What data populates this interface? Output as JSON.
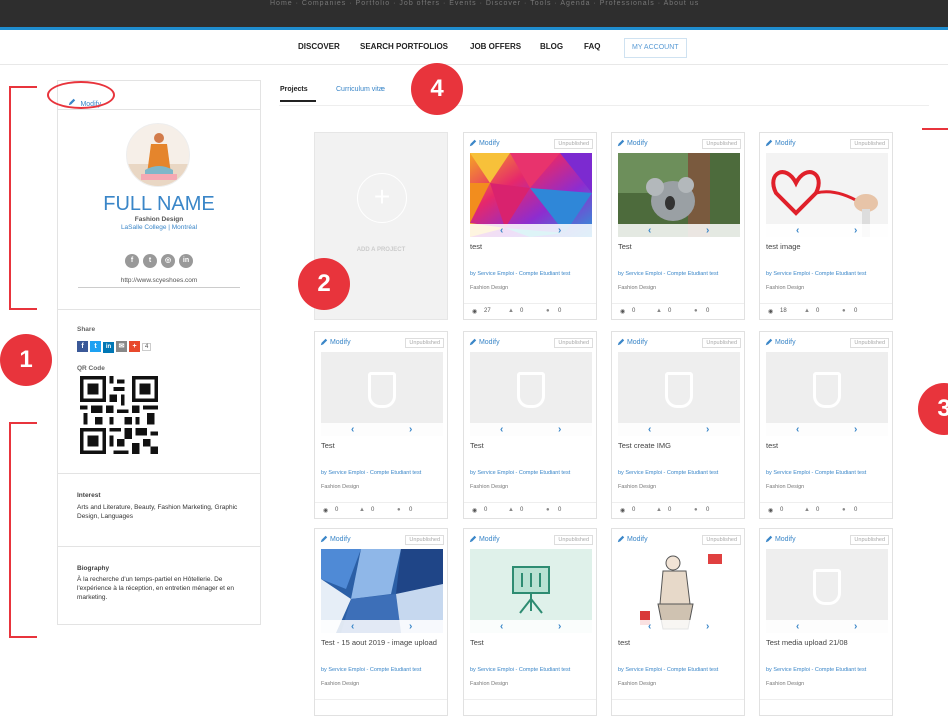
{
  "topbar": {
    "links": "Home · Companies · Portfolio · Job offers · Events · Discover · Tools · Agenda · Professionals · About us"
  },
  "nav": {
    "items": [
      "DISCOVER",
      "SEARCH PORTFOLIOS",
      "JOB OFFERS",
      "BLOG",
      "FAQ"
    ],
    "account": "MY ACCOUNT"
  },
  "sidebar": {
    "modify": "Modify",
    "full_name": "FULL NAME",
    "program": "Fashion Design",
    "school": "LaSalle College | Montréal",
    "social_icons": [
      "facebook-icon",
      "twitter-icon",
      "instagram-icon",
      "linkedin-icon"
    ],
    "website": "http://www.scyeshoes.com",
    "share_label": "Share",
    "share_count": "4",
    "qr_label": "QR Code",
    "interest_label": "Interest",
    "interest_text": "Arts and Literature, Beauty, Fashion Marketing, Graphic Design, Languages",
    "bio_label": "Biography",
    "bio_text": "À la recherche d'un temps-partiel en Hôtellerie. De l'expérience à la réception, en entretien ménager et en marketing."
  },
  "tabs": [
    "Projects",
    "Curriculum vitæ"
  ],
  "add_project": "ADD A PROJECT",
  "card_modify": "Modify",
  "card_status": "Unpublished",
  "projects": [
    {
      "title": "test",
      "author": "by Service Emploi - Compte Etudiant test",
      "category": "Fashion Design",
      "views": "27",
      "likes": "0",
      "comments": "0",
      "thumb": "polygon"
    },
    {
      "title": "Test",
      "author": "by Service Emploi - Compte Etudiant test",
      "category": "Fashion Design",
      "views": "0",
      "likes": "0",
      "comments": "0",
      "thumb": "koala"
    },
    {
      "title": "test image",
      "author": "by Service Emploi - Compte Etudiant test",
      "category": "Fashion Design",
      "views": "18",
      "likes": "0",
      "comments": "0",
      "thumb": "heart"
    },
    {
      "title": "Test",
      "author": "by Service Emploi - Compte Etudiant test",
      "category": "Fashion Design",
      "views": "0",
      "likes": "0",
      "comments": "0",
      "thumb": "empty"
    },
    {
      "title": "Test",
      "author": "by Service Emploi - Compte Etudiant test",
      "category": "Fashion Design",
      "views": "0",
      "likes": "0",
      "comments": "0",
      "thumb": "empty"
    },
    {
      "title": "Test create IMG",
      "author": "by Service Emploi - Compte Etudiant test",
      "category": "Fashion Design",
      "views": "0",
      "likes": "0",
      "comments": "0",
      "thumb": "empty"
    },
    {
      "title": "test",
      "author": "by Service Emploi - Compte Etudiant test",
      "category": "Fashion Design",
      "views": "0",
      "likes": "0",
      "comments": "0",
      "thumb": "empty"
    },
    {
      "title": "Test - 15 aout 2019 - image upload",
      "author": "by Service Emploi - Compte Etudiant test",
      "category": "Fashion Design",
      "views": "",
      "likes": "",
      "comments": "",
      "thumb": "mural"
    },
    {
      "title": "Test",
      "author": "by Service Emploi - Compte Etudiant test",
      "category": "Fashion Design",
      "views": "",
      "likes": "",
      "comments": "",
      "thumb": "board"
    },
    {
      "title": "test",
      "author": "by Service Emploi - Compte Etudiant test",
      "category": "Fashion Design",
      "views": "",
      "likes": "",
      "comments": "",
      "thumb": "sketch"
    },
    {
      "title": "Test media upload 21/08",
      "author": "by Service Emploi - Compte Etudiant test",
      "category": "Fashion Design",
      "views": "",
      "likes": "",
      "comments": "",
      "thumb": "empty"
    }
  ],
  "annotations": [
    "1",
    "2",
    "3",
    "4"
  ],
  "colors": {
    "accent": "#3a86c8",
    "marker": "#e8343c",
    "topbar": "#2e2e2e"
  }
}
